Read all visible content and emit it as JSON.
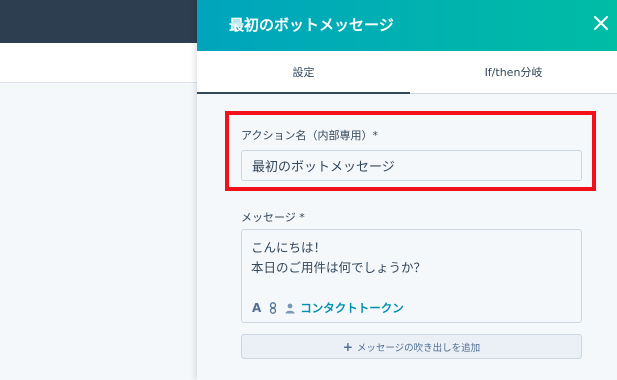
{
  "panel": {
    "title": "最初のボットメッセージ",
    "tabs": [
      {
        "label": "設定",
        "active": true
      },
      {
        "label": "If/then分岐",
        "active": false
      }
    ]
  },
  "form": {
    "action_name_label": "アクション名（内部専用）*",
    "action_name_value": "最初のボットメッセージ",
    "message_label": "メッセージ *",
    "message_text": "こんにちは！\n本日のご用件は何でしょうか？",
    "toolbar": {
      "text_format_icon": "A",
      "token_label": "コンタクトトークン"
    },
    "add_bubble_label": "メッセージの吹き出しを追加"
  },
  "colors": {
    "header_gradient_start": "#00a4bd",
    "header_gradient_end": "#00bda5",
    "highlight_border": "#f2101a",
    "link": "#0091ae",
    "dark_nav": "#2d3e50"
  }
}
